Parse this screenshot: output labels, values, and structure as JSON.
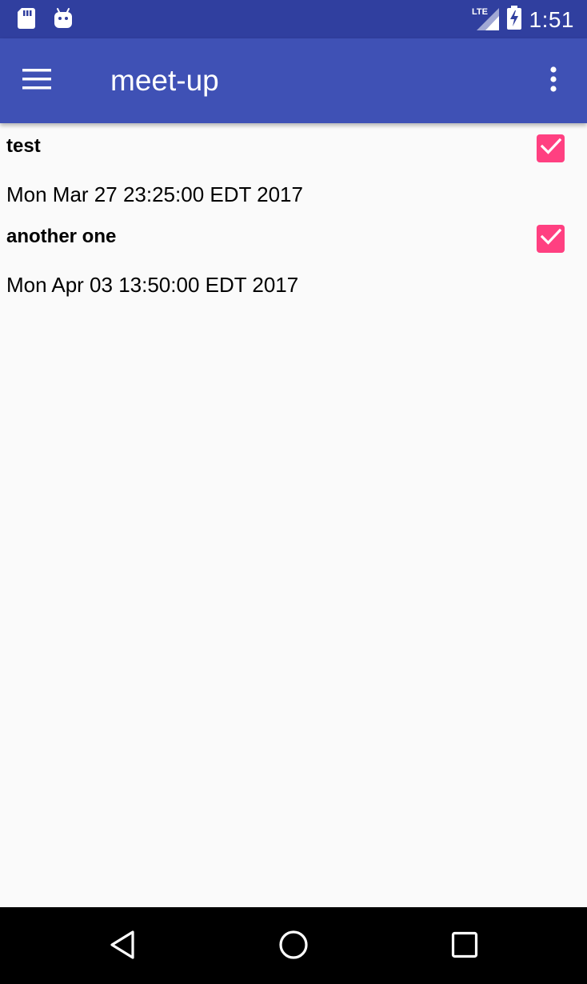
{
  "status_bar": {
    "time": "1:51",
    "network": "LTE",
    "icons": [
      "sd-card-icon",
      "android-icon",
      "lte-signal-icon",
      "battery-charging-icon"
    ],
    "color": "#303f9f"
  },
  "app_bar": {
    "title": "meet-up",
    "color": "#3f51b5",
    "icons": [
      "menu-icon",
      "overflow-menu-icon"
    ]
  },
  "events": [
    {
      "title": "test",
      "date": "Mon Mar 27 23:25:00 EDT 2017",
      "checked": true
    },
    {
      "title": "another one",
      "date": "Mon Apr 03 13:50:00 EDT 2017",
      "checked": true
    }
  ],
  "accent_color": "#ff4081",
  "nav_bar": {
    "icons": [
      "back-icon",
      "home-icon",
      "recents-icon"
    ]
  }
}
